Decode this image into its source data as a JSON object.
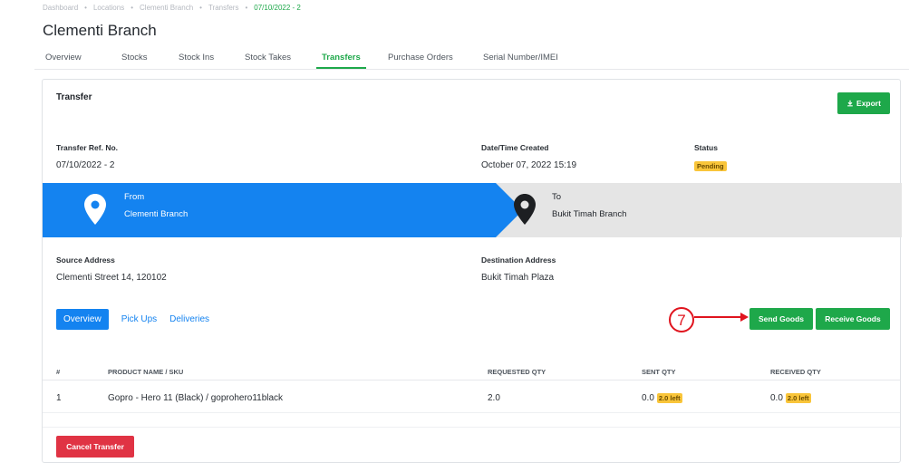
{
  "breadcrumb": [
    "Dashboard",
    "Locations",
    "Clementi Branch",
    "Transfers",
    "07/10/2022 - 2"
  ],
  "page_title": "Clementi Branch",
  "tabs": [
    "Overview",
    "Stocks",
    "Stock Ins",
    "Stock Takes",
    "Transfers",
    "Purchase Orders",
    "Serial Number/IMEI"
  ],
  "active_tab": "Transfers",
  "card": {
    "title": "Transfer",
    "export_label": "Export",
    "ref_label": "Transfer Ref. No.",
    "ref_value": "07/10/2022 - 2",
    "date_label": "Date/Time Created",
    "date_value": "October 07, 2022 15:19",
    "status_label": "Status",
    "status_value": "Pending"
  },
  "route": {
    "from_label": "From",
    "from_value": "Clementi Branch",
    "to_label": "To",
    "to_value": "Bukit Timah Branch"
  },
  "addresses": {
    "source_label": "Source Address",
    "source_value": "Clementi Street 14, 120102",
    "dest_label": "Destination Address",
    "dest_value": "Bukit Timah Plaza"
  },
  "subtabs": [
    "Overview",
    "Pick Ups",
    "Deliveries"
  ],
  "annotation_number": "7",
  "actions": {
    "send": "Send Goods",
    "receive": "Receive Goods",
    "cancel": "Cancel Transfer"
  },
  "table": {
    "headers": [
      "#",
      "PRODUCT NAME / SKU",
      "REQUESTED QTY",
      "SENT QTY",
      "RECEIVED QTY"
    ],
    "rows": [
      {
        "num": "1",
        "product": "Gopro - Hero 11 (Black) / goprohero11black",
        "requested": "2.0",
        "sent": "0.0",
        "sent_left": "2.0 left",
        "received": "0.0",
        "received_left": "2.0 left"
      }
    ]
  },
  "colors": {
    "accent_green": "#1ea84a",
    "accent_blue": "#1483f0",
    "danger_red": "#e03344",
    "warning_yellow": "#f9c53a",
    "annotation_red": "#e0141e"
  }
}
